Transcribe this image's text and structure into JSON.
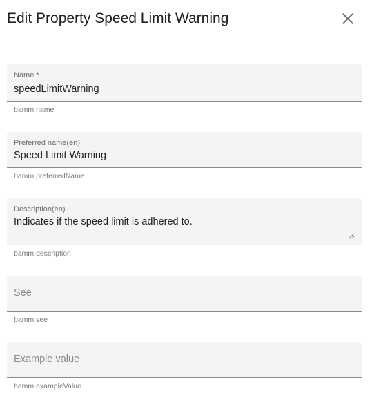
{
  "dialog": {
    "title": "Edit Property Speed Limit Warning"
  },
  "fields": {
    "name": {
      "label": "Name *",
      "value": "speedLimitWarning",
      "hint": "bamm:name"
    },
    "preferred_name": {
      "label": "Preferred name(en)",
      "value": "Speed Limit Warning",
      "hint": "bamm:preferredName"
    },
    "description": {
      "label": "Description(en)",
      "value": "Indicates if the speed limit is adhered to.",
      "hint": "bamm:description"
    },
    "see": {
      "placeholder": "See",
      "hint": "bamm:see"
    },
    "example_value": {
      "placeholder": "Example value",
      "hint": "bamm:exampleValue"
    }
  },
  "icons": {
    "close": "close-icon",
    "resize": "resize-handle-icon"
  }
}
